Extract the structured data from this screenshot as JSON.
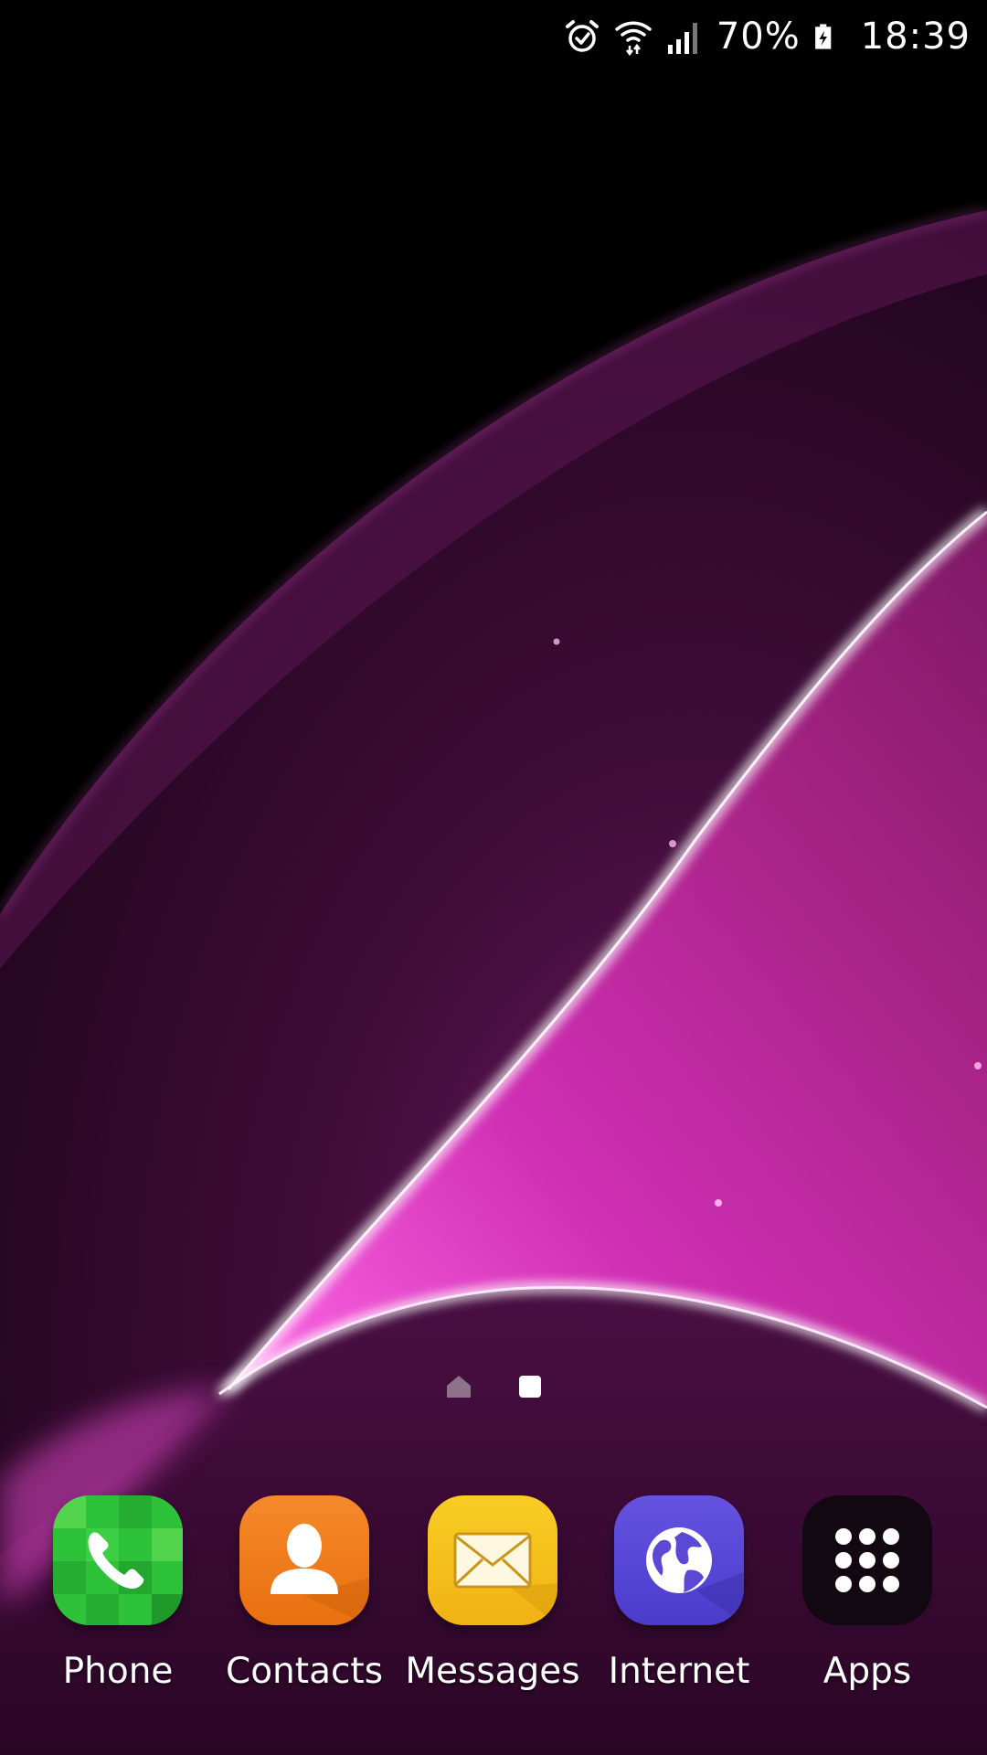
{
  "status_bar": {
    "icons": [
      "alarm-icon",
      "wifi-icon",
      "signal-icon",
      "battery-icon"
    ],
    "battery_percent": "70%",
    "time": "18:39"
  },
  "page_indicator": {
    "pages": [
      "home",
      "page"
    ],
    "current_page": 2
  },
  "dock": {
    "apps": [
      {
        "label": "Phone",
        "icon": "phone-icon",
        "color": "#2ec23a"
      },
      {
        "label": "Contacts",
        "icon": "contact-icon",
        "color": "#f07d1a"
      },
      {
        "label": "Messages",
        "icon": "envelope-icon",
        "color": "#f5c21b"
      },
      {
        "label": "Internet",
        "icon": "globe-icon",
        "color": "#5b49d6"
      },
      {
        "label": "Apps",
        "icon": "app-grid-icon",
        "color": "#120812"
      }
    ]
  },
  "wallpaper": {
    "colors": {
      "background": "#000000",
      "deep": "#3a0b33",
      "mid": "#8a1a72",
      "bright": "#e040c8",
      "highlight": "#ffffff"
    }
  }
}
